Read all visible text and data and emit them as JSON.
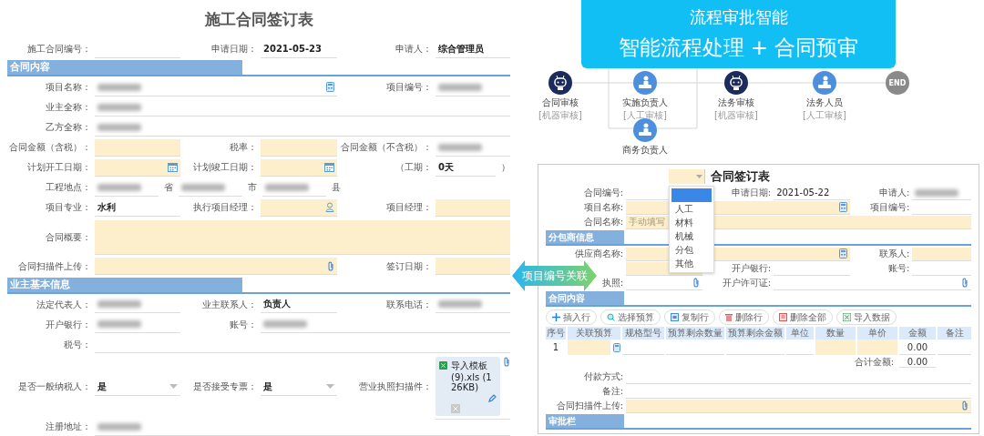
{
  "contract_form": {
    "title": "施工合同签订表",
    "rows": [
      {
        "kind": "fields",
        "fields": [
          {
            "label": "施工合同编号：",
            "kind": "text",
            "required": false,
            "blurred": false
          },
          {
            "label": "申请日期：",
            "kind": "text",
            "value": "2021-05-23",
            "required": false,
            "blurred": false
          },
          {
            "label": "申请人：",
            "kind": "text",
            "value": "综合管理员",
            "required": false,
            "blurred": false
          }
        ]
      },
      {
        "kind": "section",
        "title": "合同内容"
      },
      {
        "kind": "fields",
        "fields": [
          {
            "label": "项目名称：",
            "kind": "lookup",
            "required": false,
            "blurred": true
          },
          {
            "label": "项目编号：",
            "kind": "text",
            "required": false,
            "blurred": true
          }
        ]
      },
      {
        "kind": "fields",
        "fields": [
          {
            "label": "业主全称：",
            "kind": "text",
            "required": false,
            "blurred": true
          }
        ]
      },
      {
        "kind": "fields",
        "fields": [
          {
            "label": "乙方全称：",
            "kind": "text",
            "required": false,
            "blurred": true
          }
        ]
      },
      {
        "kind": "fields",
        "fields": [
          {
            "label": "合同金额（含税）：",
            "kind": "text",
            "required": true,
            "blurred": false
          },
          {
            "label": "税率：",
            "kind": "text",
            "required": true,
            "blurred": false
          },
          {
            "label": "合同金额（不含税）：",
            "kind": "text",
            "required": false,
            "blurred": true
          }
        ]
      },
      {
        "kind": "fields",
        "fields": [
          {
            "label": "计划开工日期：",
            "kind": "date",
            "required": true,
            "blurred": false
          },
          {
            "label": "计划竣工日期：",
            "kind": "date",
            "required": true,
            "blurred": false
          },
          {
            "label": "（工期：",
            "kind": "text",
            "value": "0天",
            "suffix": "）",
            "required": false,
            "blurred": false
          }
        ]
      },
      {
        "kind": "fields",
        "fields": [
          {
            "label": "工程地点：",
            "kind": "address",
            "parts": [
              {
                "unit": "省",
                "blurred": true
              },
              {
                "unit": "市",
                "blurred": true
              },
              {
                "unit": "县",
                "blurred": true
              }
            ]
          }
        ]
      },
      {
        "kind": "fields",
        "fields": [
          {
            "label": "项目专业：",
            "kind": "text",
            "value": "水利",
            "required": false,
            "blurred": false
          },
          {
            "label": "执行项目经理：",
            "kind": "person",
            "required": true,
            "blurred": false
          },
          {
            "label": "项目经理：",
            "kind": "text",
            "required": true,
            "blurred": false
          }
        ]
      },
      {
        "kind": "fields",
        "fields": [
          {
            "label": "合同概要：",
            "kind": "area",
            "required": true,
            "blurred": false
          }
        ]
      },
      {
        "kind": "fields",
        "fields": [
          {
            "label": "合同扫描件上传：",
            "kind": "upload",
            "required": true,
            "blurred": false
          },
          {
            "label": "签订日期：",
            "kind": "text",
            "required": true,
            "blurred": false
          }
        ]
      },
      {
        "kind": "section",
        "title": "业主基本信息"
      },
      {
        "kind": "fields",
        "fields": [
          {
            "label": "法定代表人：",
            "kind": "text",
            "required": false,
            "blurred": true
          },
          {
            "label": "业主联系人：",
            "kind": "text",
            "value": "负责人",
            "required": false,
            "blurred": false
          },
          {
            "label": "联系电话：",
            "kind": "text",
            "required": false,
            "blurred": true
          }
        ]
      },
      {
        "kind": "fields",
        "fields": [
          {
            "label": "开户银行：",
            "kind": "text",
            "required": false,
            "blurred": true
          },
          {
            "label": "账号：",
            "kind": "text",
            "required": false,
            "blurred": true
          }
        ]
      },
      {
        "kind": "fields",
        "fields": [
          {
            "label": "税号：",
            "kind": "text",
            "required": false,
            "blurred": false
          }
        ]
      },
      {
        "kind": "fields",
        "fields": [
          {
            "label": "是否一般纳税人：",
            "kind": "select",
            "value": "是",
            "required": false,
            "blurred": false
          },
          {
            "label": "是否接受专票：",
            "kind": "select",
            "value": "是",
            "required": false,
            "blurred": false
          },
          {
            "label": "营业执照扫描件：",
            "kind": "file",
            "file": "导入模板 (9).xls (126KB)",
            "required": false,
            "blurred": false
          }
        ]
      },
      {
        "kind": "fields",
        "fields": [
          {
            "label": "注册地址：",
            "kind": "text",
            "required": false,
            "blurred": true
          }
        ]
      }
    ]
  },
  "workflow": {
    "banner": {
      "title": "流程审批智能",
      "subtitle": "智能流程处理 + 合同预审"
    },
    "nodes": [
      {
        "kind": "robot",
        "label": "合同审核",
        "sub": "[机器审核]"
      },
      {
        "kind": "person",
        "label": "实施负责人",
        "sub": "[人工审核]"
      },
      {
        "kind": "robot",
        "label": "法务审核",
        "sub": "[机器审核]"
      },
      {
        "kind": "person",
        "label": "法务人员",
        "sub": "[人工审核]"
      },
      {
        "kind": "end",
        "label": "END"
      }
    ],
    "branch": {
      "kind": "person",
      "label": "商务负责人"
    }
  },
  "link_arrow": {
    "label": "项目编号关联"
  },
  "review_form": {
    "title": "合同签订表",
    "type_select": {
      "required": true,
      "options": [
        {
          "selected": true
        },
        {
          "label": "人工",
          "selected": false
        },
        {
          "label": "材料",
          "selected": false
        },
        {
          "label": "机械",
          "selected": false
        },
        {
          "label": "分包",
          "selected": false
        },
        {
          "label": "其他",
          "selected": false
        }
      ]
    },
    "rows": [
      {
        "kind": "fields",
        "fields": [
          {
            "label": "合同编号:",
            "kind": "text",
            "required": false,
            "blurred": false
          },
          {
            "label": "申请日期:",
            "kind": "text",
            "value": "2021-05-22",
            "required": false,
            "blurred": false
          },
          {
            "label": "申请人:",
            "kind": "text",
            "required": false,
            "blurred": true
          }
        ]
      },
      {
        "kind": "fields",
        "fields": [
          {
            "label": "项目名称:",
            "kind": "lookup",
            "required": true,
            "blurred": false
          },
          {
            "label": "项目编号:",
            "kind": "text",
            "required": false,
            "blurred": false
          }
        ]
      },
      {
        "kind": "fields",
        "fields": [
          {
            "label": "合同名称:",
            "kind": "text",
            "placeholder": "手动填写",
            "required": true,
            "blurred": false
          }
        ]
      },
      {
        "kind": "section",
        "title": "分包商信息"
      },
      {
        "kind": "fields",
        "fields": [
          {
            "label": "供应商名称:",
            "kind": "lookup",
            "required": true,
            "blurred": false
          },
          {
            "label": "联系人:",
            "kind": "text",
            "required": true,
            "blurred": false
          }
        ]
      },
      {
        "kind": "fields",
        "fields": [
          {
            "kind": "text",
            "required": true,
            "blurred": false
          },
          {
            "label": "开户银行:",
            "kind": "text",
            "required": false,
            "blurred": false
          },
          {
            "label": "账号:",
            "kind": "text",
            "required": false,
            "blurred": false
          }
        ]
      },
      {
        "kind": "fields",
        "fields": [
          {
            "label": "执照:",
            "kind": "attach",
            "required": false,
            "blurred": false
          },
          {
            "label": "开户许可证:",
            "kind": "attach",
            "required": false,
            "blurred": false
          }
        ]
      },
      {
        "kind": "section",
        "title": "合同内容"
      },
      {
        "kind": "toolbar",
        "buttons": [
          {
            "kind": "insert",
            "label": "插入行"
          },
          {
            "kind": "budget",
            "label": "选择预算"
          },
          {
            "kind": "copy",
            "label": "复制行"
          },
          {
            "kind": "delete",
            "label": "删除行"
          },
          {
            "kind": "delete_all",
            "label": "删除全部"
          },
          {
            "kind": "import",
            "label": "导入数据"
          }
        ]
      },
      {
        "kind": "table",
        "columns": [
          "序号",
          "关联预算",
          "规格型号",
          "预算剩余数量",
          "预算剩余金额",
          "单位",
          "数量",
          "单价",
          "金额",
          "备注"
        ],
        "rows": [
          {
            "cells": [
              {
                "kind": "text",
                "value": "1",
                "required": false
              },
              {
                "kind": "lookup",
                "required": true
              },
              {
                "kind": "text",
                "required": false
              },
              {
                "kind": "text",
                "required": false
              },
              {
                "kind": "text",
                "required": false
              },
              {
                "kind": "text",
                "required": false
              },
              {
                "kind": "text",
                "required": true
              },
              {
                "kind": "text",
                "required": true
              },
              {
                "kind": "text",
                "value": "0.00",
                "required": false
              },
              {
                "kind": "text",
                "required": false
              }
            ]
          }
        ]
      },
      {
        "kind": "total",
        "label": "合计金额:",
        "value": "0.00"
      },
      {
        "kind": "fields",
        "fields": [
          {
            "label": "付款方式:",
            "kind": "text",
            "required": false,
            "blurred": false
          }
        ]
      },
      {
        "kind": "fields",
        "fields": [
          {
            "label": "备注:",
            "kind": "text",
            "required": false,
            "blurred": false
          }
        ]
      },
      {
        "kind": "fields",
        "fields": [
          {
            "label": "合同扫描件上传:",
            "kind": "upload",
            "required": true,
            "blurred": false
          }
        ]
      },
      {
        "kind": "section",
        "title": "审批栏"
      }
    ]
  }
}
